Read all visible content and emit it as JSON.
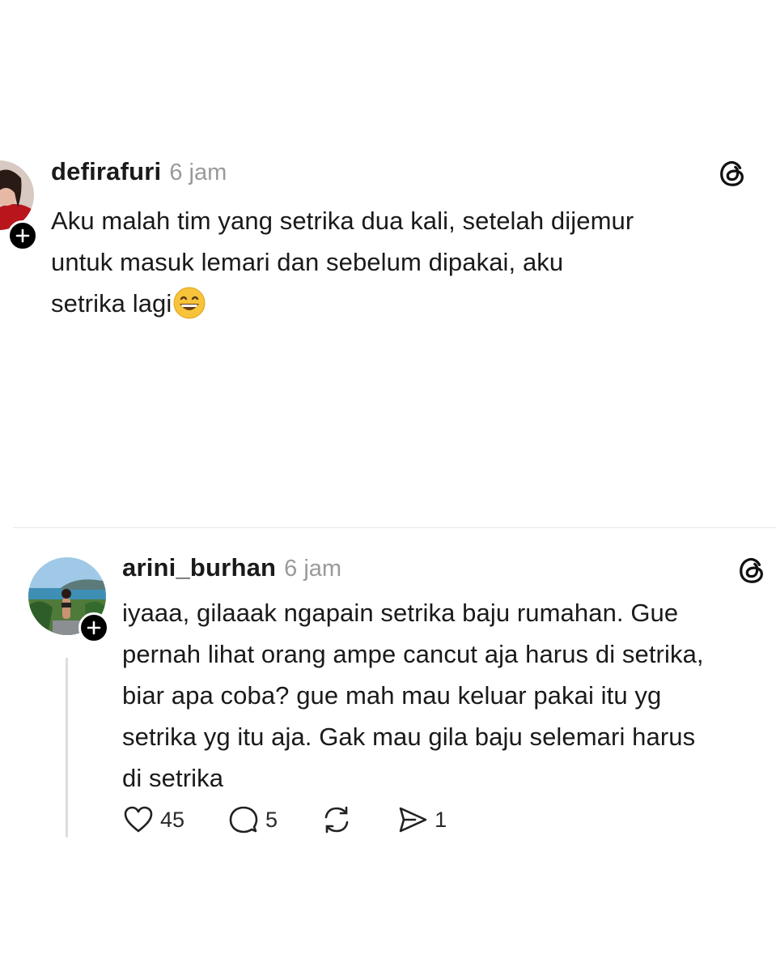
{
  "posts": [
    {
      "username": "defirafuri",
      "time": "6 jam",
      "text": "Aku malah tim yang setrika dua kali, setelah dijemur\nuntuk masuk lemari dan sebelum dipakai, aku\nsetrika lagi",
      "emoji": "grinning-face-icon"
    },
    {
      "username": "arini_burhan",
      "time": "6 jam",
      "text": "iyaaa, gilaaak ngapain setrika baju rumahan. Gue\npernah lihat orang ampe cancut aja harus di setrika,\nbiar apa coba? gue mah mau keluar pakai itu yg\nsetrika yg itu aja. Gak mau gila baju selemari harus\ndi setrika",
      "actions": {
        "likes": "45",
        "replies": "5",
        "shares": "1"
      }
    }
  ],
  "icons": {
    "threads": "threads-logo-icon",
    "follow": "plus-icon",
    "like": "heart-icon",
    "reply": "comment-icon",
    "repost": "repost-icon",
    "share": "send-icon"
  },
  "colors": {
    "text": "#1a1a1a",
    "muted": "#9a9a9a",
    "divider": "#e6e6e6"
  }
}
